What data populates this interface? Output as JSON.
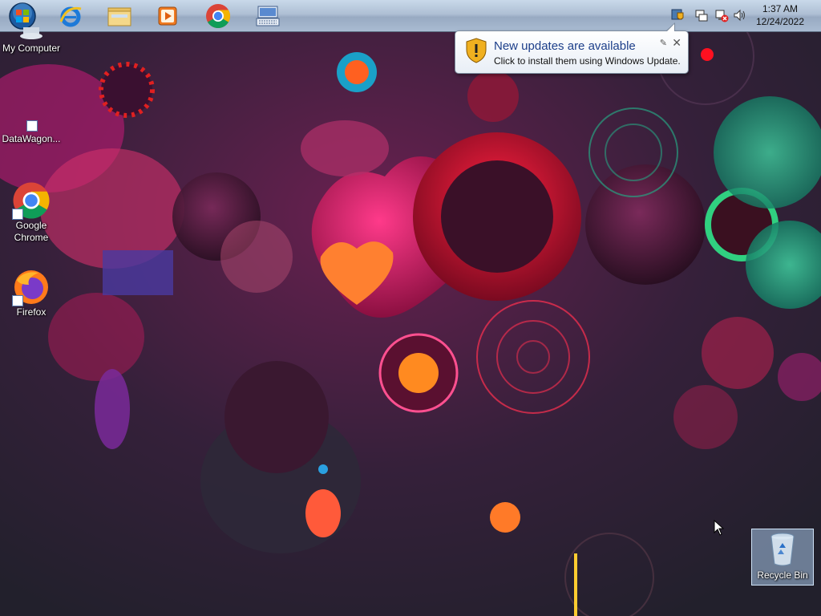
{
  "taskbar": {
    "items": [
      {
        "name": "start-button",
        "icon": "windows-orb-icon"
      },
      {
        "name": "internet-explorer",
        "icon": "ie-icon"
      },
      {
        "name": "windows-explorer",
        "icon": "folder-icon"
      },
      {
        "name": "media-player",
        "icon": "media-player-icon"
      },
      {
        "name": "google-chrome",
        "icon": "chrome-icon"
      },
      {
        "name": "on-screen-keyboard",
        "icon": "keyboard-icon"
      }
    ],
    "tray": {
      "time": "1:37 AM",
      "date": "12/24/2022"
    }
  },
  "desktop": {
    "icons": [
      {
        "label": "My Computer"
      },
      {
        "label": "DataWagon..."
      },
      {
        "label": "Google Chrome"
      },
      {
        "label": "Firefox"
      },
      {
        "label": "Recycle Bin"
      }
    ]
  },
  "balloon": {
    "title": "New updates are available",
    "message": "Click to install them using Windows Update."
  },
  "colors": {
    "taskbar": "#a9bbd2",
    "wallpaper_base": "#2a2030",
    "accent_magenta": "#c8145a",
    "accent_orange": "#ff7a28",
    "accent_teal": "#1e8a74"
  }
}
